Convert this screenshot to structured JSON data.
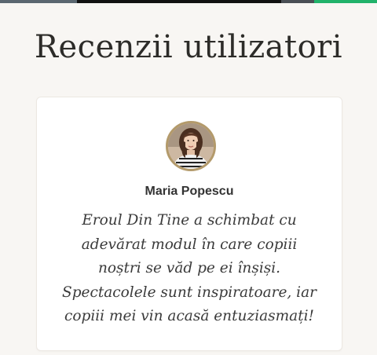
{
  "section": {
    "title": "Recenzii utilizatori"
  },
  "review": {
    "reviewer_name": "Maria Popescu",
    "avatar_icon": "user-photo-avatar",
    "text": "Eroul Din Tine a schimbat cu adevărat modul în care copiii noștri se văd pe ei înșiși. Spectacolele sunt inspiratoare, iar copiii mei vin acasă entuziasmați!"
  },
  "colors": {
    "background": "#f8f6f3",
    "card": "#ffffff",
    "avatar_border": "#b39a6b",
    "accent_green": "#21b26a"
  }
}
